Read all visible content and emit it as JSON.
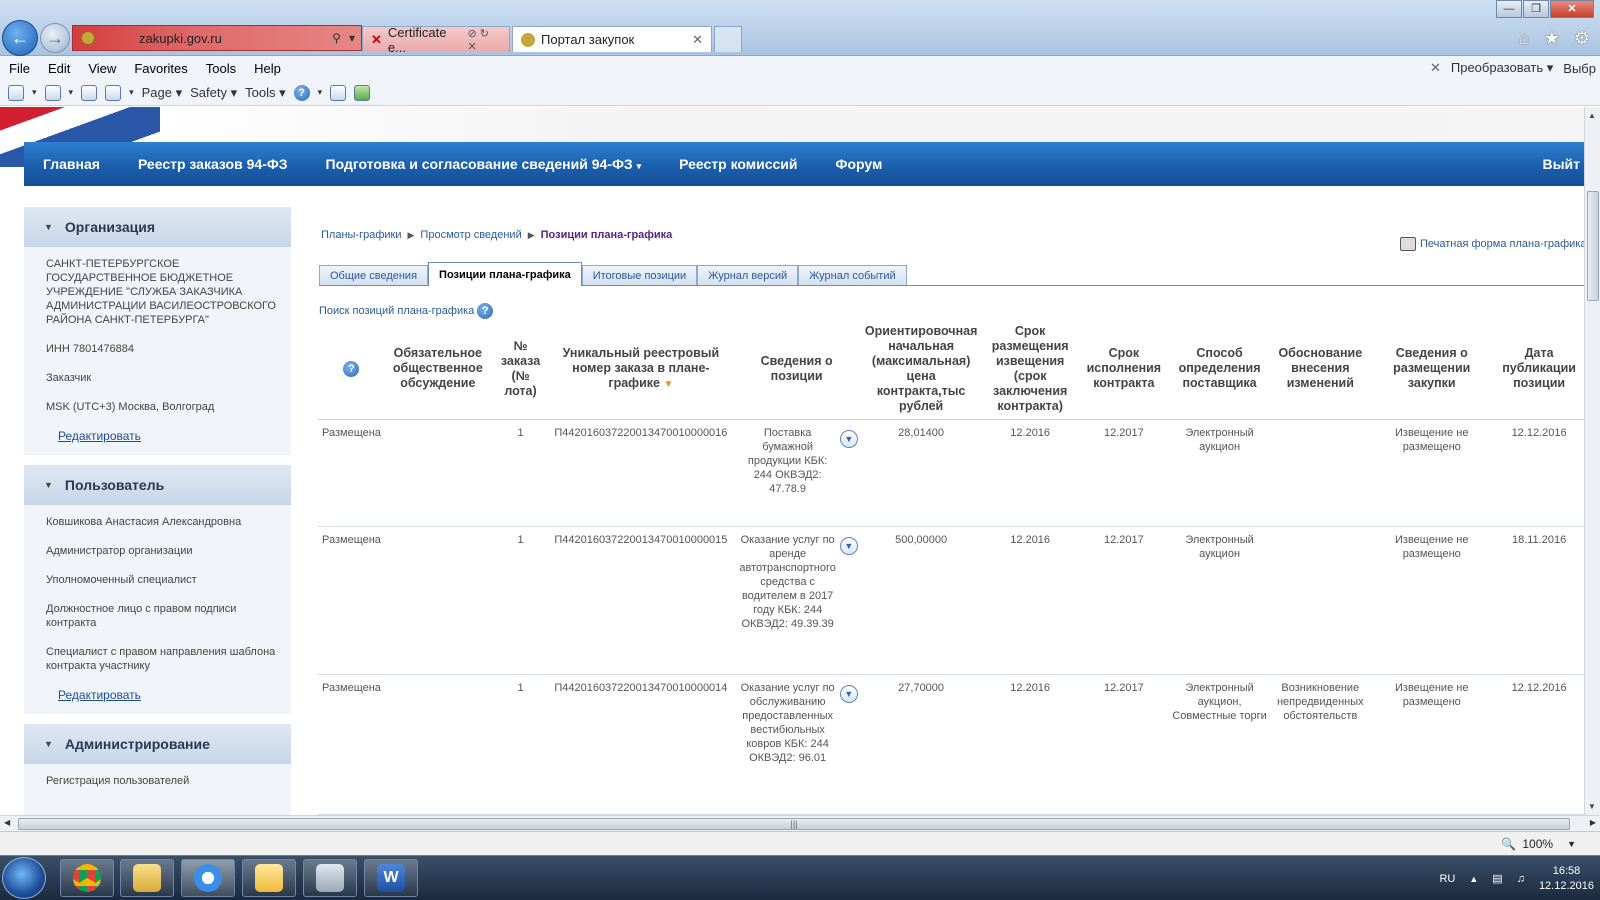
{
  "browser": {
    "address": "zakupki.gov.ru",
    "tabs": [
      {
        "title": "Certificate e..."
      },
      {
        "title": "Портал закупок"
      }
    ],
    "menu": [
      "File",
      "Edit",
      "View",
      "Favorites",
      "Tools",
      "Help"
    ],
    "menu_right": [
      "Преобразовать",
      "Выбр"
    ],
    "commands": [
      "Page",
      "Safety",
      "Tools"
    ],
    "zoom": "100%"
  },
  "topnav": {
    "items": [
      "Главная",
      "Реестр заказов 94-ФЗ",
      "Подготовка и согласование сведений 94-ФЗ",
      "Реестр комиссий",
      "Форум"
    ],
    "exit": "Выйт"
  },
  "sidebar": {
    "org": {
      "title": "Организация",
      "name": "САНКТ-ПЕТЕРБУРГСКОЕ ГОСУДАРСТВЕННОЕ БЮДЖЕТНОЕ УЧРЕЖДЕНИЕ \"СЛУЖБА ЗАКАЗЧИКА АДМИНИСТРАЦИИ ВАСИЛЕОСТРОВСКОГО РАЙОНА САНКТ-ПЕТЕРБУРГА\"",
      "inn": "ИНН 7801476884",
      "role": "Заказчик",
      "tz": "MSK (UTC+3) Москва, Волгоград",
      "edit": "Редактировать"
    },
    "user": {
      "title": "Пользователь",
      "name": "Ковшикова Анастасия Александровна",
      "roles": [
        "Администратор организации",
        "Уполномоченный специалист",
        "Должностное лицо с правом подписи контракта",
        "Специалист с правом направления шаблона контракта участнику"
      ],
      "edit": "Редактировать"
    },
    "admin": {
      "title": "Администрирование",
      "first_item": "Регистрация пользователей"
    }
  },
  "main": {
    "breadcrumbs": [
      "Планы-графики",
      "Просмотр сведений",
      "Позиции плана-графика"
    ],
    "print": "Печатная форма плана-графика",
    "tabs": [
      "Общие сведения",
      "Позиции плана-графика",
      "Итоговые позиции",
      "Журнал версий",
      "Журнал событий"
    ],
    "search": "Поиск позиций плана-графика",
    "columns": [
      "?",
      "Обязательное общественное обсуждение",
      "№ заказа (№ лота)",
      "Уникальный реестровый номер заказа в плане-графике",
      "Сведения о позиции",
      "Ориентировочная начальная (максимальная) цена контракта,тыс рублей",
      "Срок размещения извещения (срок заключения контракта)",
      "Срок исполнения контракта",
      "Способ определения поставщика",
      "Обоснование внесения изменений",
      "Сведения о размещении закупки",
      "Дата публикации позиции"
    ],
    "rows": [
      {
        "status": "Размещена",
        "discussion": "",
        "lot": "1",
        "number": "П442016037220013470010000016",
        "info": "Поставка бумажной продукции КБК: 244 ОКВЭД2: 47.78.9",
        "price": "28,01400",
        "placement": "12.2016",
        "execution": "12.2017",
        "method": "Электронный аукцион",
        "reason": "",
        "procurement": "Извещение не размещено",
        "published": "12.12.2016"
      },
      {
        "status": "Размещена",
        "discussion": "",
        "lot": "1",
        "number": "П442016037220013470010000015",
        "info": "Оказание услуг по аренде автотранспортного средства с водителем в 2017 году КБК: 244 ОКВЭД2: 49.39.39",
        "price": "500,00000",
        "placement": "12.2016",
        "execution": "12.2017",
        "method": "Электронный аукцион",
        "reason": "",
        "procurement": "Извещение не размещено",
        "published": "18.11.2016"
      },
      {
        "status": "Размещена",
        "discussion": "",
        "lot": "1",
        "number": "П442016037220013470010000014",
        "info": "Оказание услуг по обслуживанию предоставленных вестибюльных ковров КБК: 244 ОКВЭД2: 96.01",
        "price": "27,70000",
        "placement": "12.2016",
        "execution": "12.2017",
        "method": "Электронный аукцион, Совместные торги",
        "reason": "Возникновение непредвиденных обстоятельств",
        "procurement": "Извещение не размещено",
        "published": "12.12.2016"
      }
    ]
  },
  "taskbar": {
    "lang": "RU",
    "time": "16:58",
    "date": "12.12.2016"
  }
}
